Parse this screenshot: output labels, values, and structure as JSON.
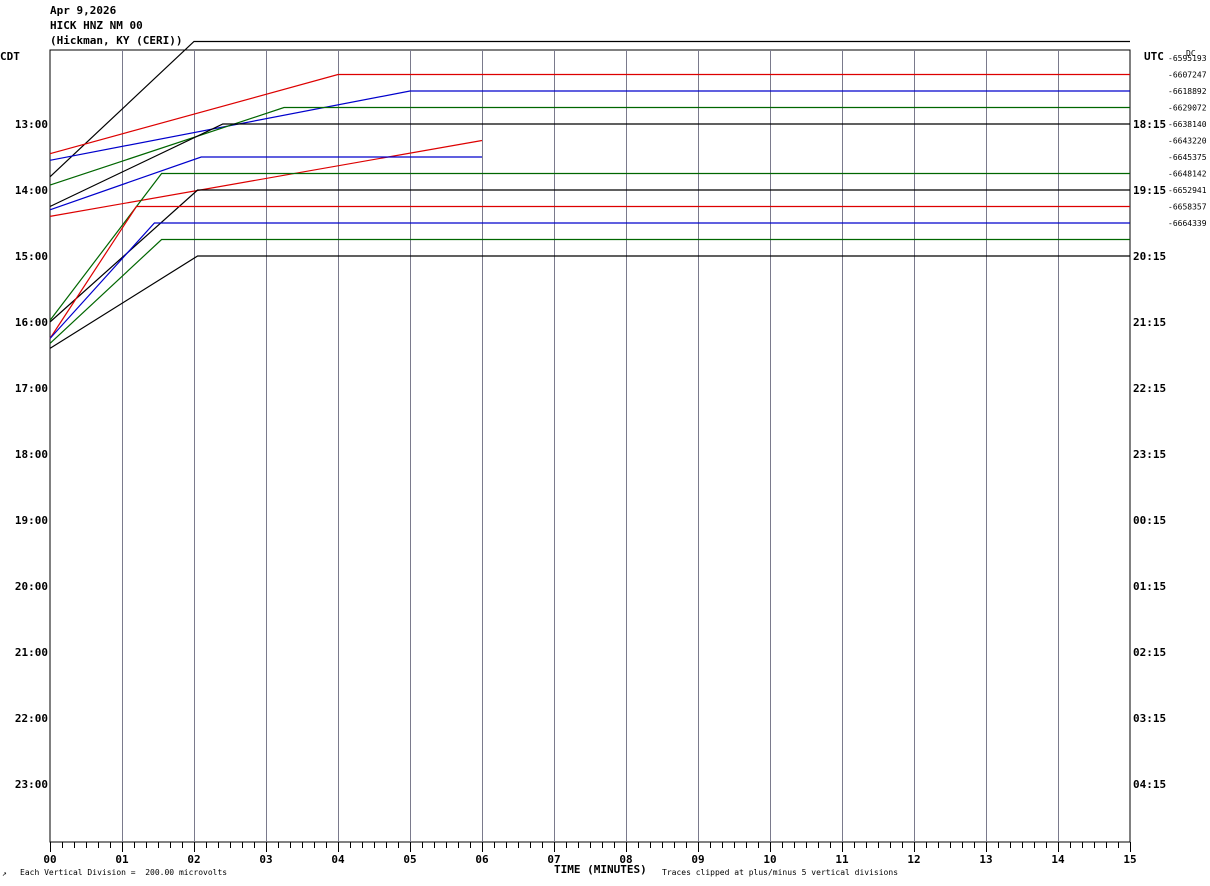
{
  "header": {
    "date": "Apr 9,2026",
    "station": "HICK HNZ NM 00",
    "location": "(Hickman, KY (CERI))"
  },
  "left_tz": "CDT",
  "right_tz": "UTC",
  "dc_label": "DC",
  "footer": {
    "scale_mark": "↗",
    "vertical_division": "Each Vertical Division =  200.00 microvolts",
    "clip_note": "Traces clipped at plus/minus 5 vertical divisions"
  },
  "chart_data": {
    "type": "line",
    "title": "",
    "xlabel": "TIME (MINUTES)",
    "xlim": [
      0,
      15
    ],
    "x_ticks": [
      "00",
      "01",
      "02",
      "03",
      "04",
      "05",
      "06",
      "07",
      "08",
      "09",
      "10",
      "11",
      "12",
      "13",
      "14",
      "15"
    ],
    "left_hour_labels": [
      "13:00",
      "14:00",
      "15:00",
      "16:00",
      "17:00",
      "18:00",
      "19:00",
      "20:00",
      "21:00",
      "22:00",
      "23:00"
    ],
    "right_hour_labels": [
      "18:15",
      "19:15",
      "20:15",
      "21:15",
      "22:15",
      "23:15",
      "00:15",
      "01:15",
      "02:15",
      "03:15",
      "04:15"
    ],
    "dc_offsets": [
      "-6595193",
      "-6607247",
      "-6618892",
      "-6629072",
      "-6638140",
      "-6643220",
      "-6645375",
      "-6648142",
      "-6652941",
      "-6658357",
      "-6664339"
    ],
    "colors": {
      "black": "#000000",
      "red": "#dd0000",
      "blue": "#0000cc",
      "green": "#006600",
      "grid": "#7a7a8c"
    },
    "traces": [
      {
        "color": "black",
        "points": [
          [
            0,
            -7.2
          ],
          [
            2.0,
            1.0
          ],
          [
            15,
            1.0
          ]
        ]
      },
      {
        "color": "red",
        "points": [
          [
            0,
            -4.8
          ],
          [
            4.0,
            0.0
          ],
          [
            15,
            0.0
          ]
        ]
      },
      {
        "color": "blue",
        "points": [
          [
            0,
            -4.2
          ],
          [
            5.0,
            0.0
          ],
          [
            15,
            0.0
          ]
        ]
      },
      {
        "color": "green",
        "points": [
          [
            0,
            -4.7
          ],
          [
            3.25,
            0.0
          ],
          [
            15,
            0.0
          ]
        ]
      },
      {
        "color": "black",
        "points": [
          [
            0,
            -5.0
          ],
          [
            2.4,
            0.0
          ],
          [
            15,
            0.0
          ]
        ]
      },
      {
        "color": "red",
        "points": [
          [
            0,
            -4.6
          ],
          [
            6.0,
            0.0
          ]
        ]
      },
      {
        "color": "blue",
        "points": [
          [
            0,
            -3.2
          ],
          [
            2.1,
            0.0
          ],
          [
            6.0,
            0.0
          ]
        ]
      },
      {
        "color": "green",
        "points": [
          [
            0,
            -8.9
          ],
          [
            1.55,
            0.0
          ],
          [
            15,
            0.0
          ]
        ]
      },
      {
        "color": "black",
        "points": [
          [
            0,
            -8.0
          ],
          [
            2.05,
            0.0
          ],
          [
            15,
            0.0
          ]
        ]
      },
      {
        "color": "red",
        "points": [
          [
            0,
            -8.0
          ],
          [
            1.2,
            0.0
          ],
          [
            15,
            0.0
          ]
        ]
      },
      {
        "color": "blue",
        "points": [
          [
            0,
            -7.0
          ],
          [
            1.45,
            0.0
          ],
          [
            15,
            0.0
          ]
        ]
      },
      {
        "color": "green",
        "points": [
          [
            0,
            -6.3
          ],
          [
            1.55,
            0.0
          ],
          [
            15,
            0.0
          ]
        ]
      },
      {
        "color": "black",
        "points": [
          [
            0,
            -5.6
          ],
          [
            2.05,
            0.0
          ],
          [
            15,
            0.0
          ]
        ]
      }
    ]
  }
}
